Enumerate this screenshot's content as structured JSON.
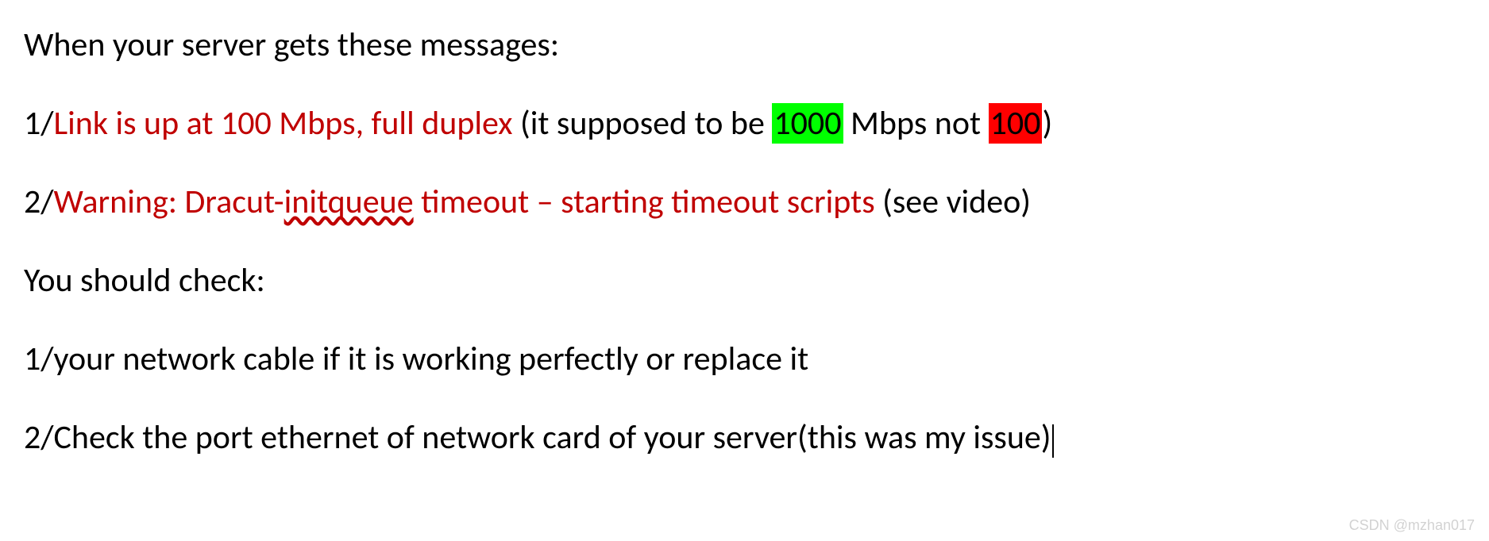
{
  "lines": {
    "l1": "When your server gets these messages:",
    "l2": {
      "prefix": "1/",
      "red": "Link is up at 100 Mbps, full duplex",
      "afterRed": " (it supposed to be ",
      "hlGreen": "1000",
      "mid": " Mbps not ",
      "hlRed": "100",
      "suffix": ")"
    },
    "l3": {
      "prefix": "2/",
      "red_before": "Warning: Dracut-",
      "red_squiggle": "initqueue",
      "red_after": " timeout – starting timeout scripts",
      "suffix": " (see video)"
    },
    "l4": "You should check:",
    "l5": "1/your network cable if it is working perfectly or replace it",
    "l6": "2/Check the port ethernet of network card of your server(this was my issue)"
  },
  "watermark": "CSDN @mzhan017"
}
